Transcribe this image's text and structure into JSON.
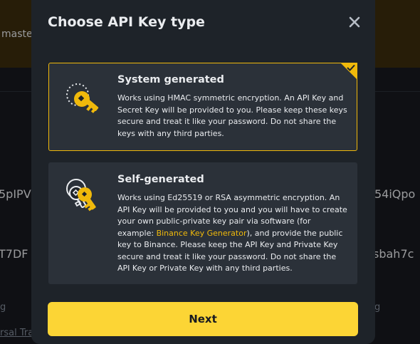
{
  "background": {
    "banner_text": "maste",
    "left_row1": "5pIPV",
    "right_row1": "54iQpo",
    "left_row2": "T7DF",
    "right_row2": "sbah7c",
    "left_small": "g",
    "right_small": "g",
    "left_link": "rsal Tra"
  },
  "modal": {
    "title": "Choose API Key type",
    "close_icon": "close-icon",
    "next_label": "Next"
  },
  "options": [
    {
      "title": "System generated",
      "selected": true,
      "icon": "key-icon",
      "description": "Works using HMAC symmetric encryption. An API Key and Secret Key will be provided to you. Please keep these keys secure and treat it like your password. Do not share the keys with any third parties."
    },
    {
      "title": "Self-generated",
      "selected": false,
      "icon": "keys-icon",
      "description_before": "Works using Ed25519 or RSA asymmetric encryption. An API Key will be provided to you and you will have to create your own public-private key pair via software (for example: ",
      "link_text": "Binance Key Generator",
      "description_after": "), and provide the public key to Binance. Please keep the API Key and Private Key secure and treat it like your password. Do not share the API Key or Private Key with any third parties."
    }
  ],
  "colors": {
    "accent": "#f0b90b",
    "button": "#fcd535",
    "modal_bg": "#1e2329",
    "card_bg": "#2b3139"
  }
}
